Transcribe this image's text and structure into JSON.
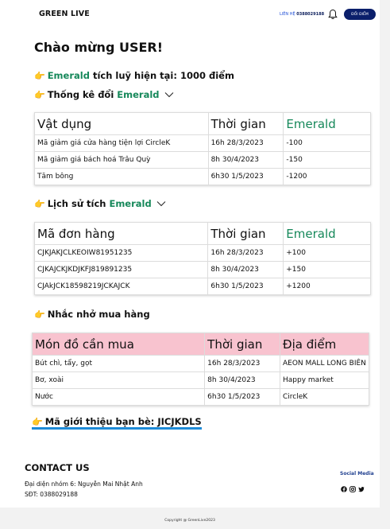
{
  "header": {
    "brand": "GREEN LIVE",
    "hotline_label": "LIÊN HỆ",
    "hotline_number": "0388029188",
    "redeem_button": "ĐỔI ĐIỂM"
  },
  "main": {
    "welcome": "Chào mừng USER!",
    "points": {
      "hand": "👉",
      "currency": "Emerald",
      "text": " tích luỹ hiện tại: 1000 điểm"
    },
    "exchange_stats": {
      "hand": "👉",
      "label": "Thống kê đổi ",
      "currency": "Emerald"
    },
    "exchange_table": {
      "headers": [
        "Vật dụng",
        "Thời gian",
        "Emerald"
      ],
      "rows": [
        [
          "Mã giảm giá cửa hàng tiện lợi CircleK",
          "16h 28/3/2023",
          "-100"
        ],
        [
          "Mã giảm giá bách hoá Trâu Quỳ",
          "8h 30/4/2023",
          "-150"
        ],
        [
          "Tăm bông",
          "6h30 1/5/2023",
          "-1200"
        ]
      ]
    },
    "earn_history": {
      "hand": "👉",
      "label": "Lịch sử tích ",
      "currency": "Emerald"
    },
    "earn_table": {
      "headers": [
        "Mã đơn hàng",
        "Thời gian",
        "Emerald"
      ],
      "rows": [
        [
          "CJKJAKJCLKEOIW81951235",
          "16h 28/3/2023",
          "+100"
        ],
        [
          "CJKAJCKJKDJKFJ819891235",
          "8h 30/4/2023",
          "+150"
        ],
        [
          "CJAkJCK18598219JCKAJCK",
          "6h30 1/5/2023",
          "+1200"
        ]
      ]
    },
    "reminder": {
      "hand": "👉",
      "label": "Nhắc nhở mua hàng"
    },
    "reminder_table": {
      "headers": [
        "Món đồ cần mua",
        "Thời gian",
        "Địa điểm"
      ],
      "rows": [
        [
          "Bút chì, tẩy, gọt",
          "16h 28/3/2023",
          "AEON MALL LONG BIÊN"
        ],
        [
          "Bơ, xoài",
          "8h 30/4/2023",
          "Happy market"
        ],
        [
          "Nước",
          "6h30 1/5/2023",
          "CircleK"
        ]
      ]
    },
    "referral": {
      "hand": "👉",
      "text": "Mã giới thiệu bạn bè: JICJKDLS"
    }
  },
  "footer": {
    "contact_title": "CONTACT US",
    "representative": "Đại diện nhóm 6: Nguyễn Mai Nhật Anh",
    "phone": "SĐT: 0388029188",
    "social_title": "Social Media",
    "social_icons": [
      "facebook-icon",
      "instagram-icon",
      "twitter-icon"
    ],
    "copyright": "Copyright @ GreenLive2023"
  },
  "colors": {
    "accent_green": "#16885a",
    "navy": "#0b1f6b",
    "pink_header": "#f8c3cf",
    "underline_blue": "#1e8bd8"
  }
}
